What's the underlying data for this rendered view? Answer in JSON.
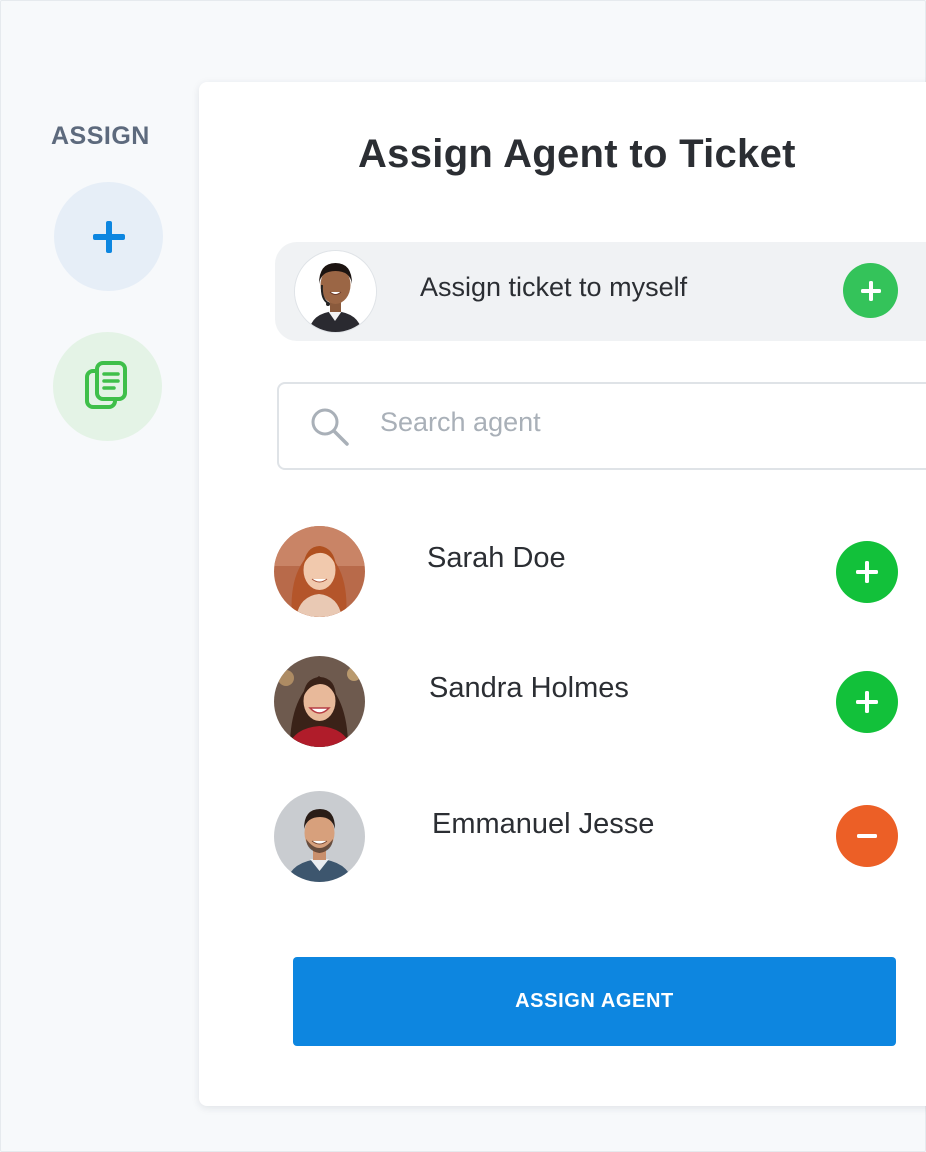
{
  "sidebar": {
    "label": "ASSIGN",
    "buttons": [
      {
        "icon": "plus-icon",
        "color": "#0d86e0",
        "bg": "#e6eef7"
      },
      {
        "icon": "documents-icon",
        "color": "#3fbf4a",
        "bg": "#e4f3e6"
      }
    ]
  },
  "dialog": {
    "title": "Assign Agent to Ticket",
    "self_assign": {
      "label": "Assign ticket to myself",
      "action_icon": "plus-icon",
      "action_color": "#34c35a"
    },
    "search": {
      "placeholder": "Search agent",
      "value": ""
    },
    "agents": [
      {
        "name": "Sarah Doe",
        "action": "add",
        "action_icon": "plus-icon",
        "action_color": "#12c13a"
      },
      {
        "name": "Sandra Holmes",
        "action": "add",
        "action_icon": "plus-icon",
        "action_color": "#12c13a"
      },
      {
        "name": "Emmanuel Jesse",
        "action": "remove",
        "action_icon": "minus-icon",
        "action_color": "#ec5f26"
      }
    ],
    "submit_label": "ASSIGN AGENT",
    "accent_color": "#0d86e0"
  }
}
